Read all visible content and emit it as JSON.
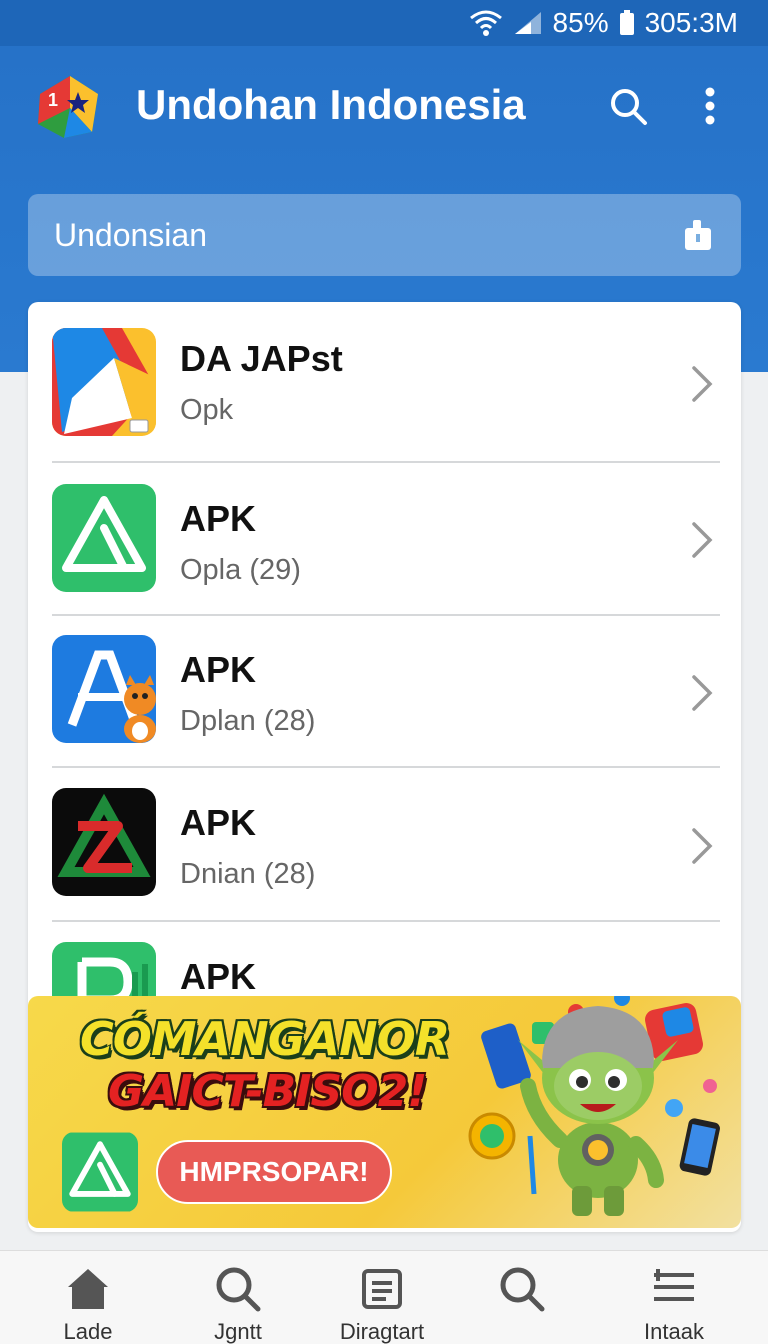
{
  "status_bar": {
    "battery": "85%",
    "time": "305:3M",
    "icons": [
      "wifi-icon",
      "signal-icon",
      "battery-icon"
    ]
  },
  "header": {
    "title": "Undohan Indonesia",
    "field_label": "Undonsian",
    "icons": [
      "app-logo-icon",
      "search-icon",
      "more-vertical-icon",
      "lock-icon"
    ]
  },
  "list": {
    "items": [
      {
        "title": "DA JAPst",
        "subtitle": "Opk",
        "icon": "colorful-triangle-app-icon"
      },
      {
        "title": "APK",
        "subtitle": "Opla (29)",
        "icon": "green-triangle-app-icon"
      },
      {
        "title": "APK",
        "subtitle": "Dplan (28)",
        "icon": "blue-a-fox-app-icon"
      },
      {
        "title": "APK",
        "subtitle": "Dnian (28)",
        "icon": "black-red-green-app-icon"
      },
      {
        "title": "APK",
        "subtitle": "",
        "icon": "green-r-app-icon"
      }
    ]
  },
  "banner": {
    "headline": "CÓMANGANOR",
    "subline": "GAICT-BISO2!",
    "cta_label": "HMPRSOPAR!",
    "icons": [
      "green-triangle-app-icon",
      "robot-mascot-icon"
    ]
  },
  "bottom_nav": {
    "items": [
      {
        "label": "Lade",
        "icon": "home-icon"
      },
      {
        "label": "Jgntt",
        "icon": "search-icon"
      },
      {
        "label": "Diragtart",
        "icon": "document-icon"
      },
      {
        "label": "",
        "icon": "search-icon"
      },
      {
        "label": "Intaak",
        "icon": "list-icon"
      }
    ]
  },
  "colors": {
    "header_blue": "#2672c8",
    "status_blue": "#1e66b8",
    "banner_yellow": "#f7d94a",
    "cta_red": "#e85a55"
  }
}
